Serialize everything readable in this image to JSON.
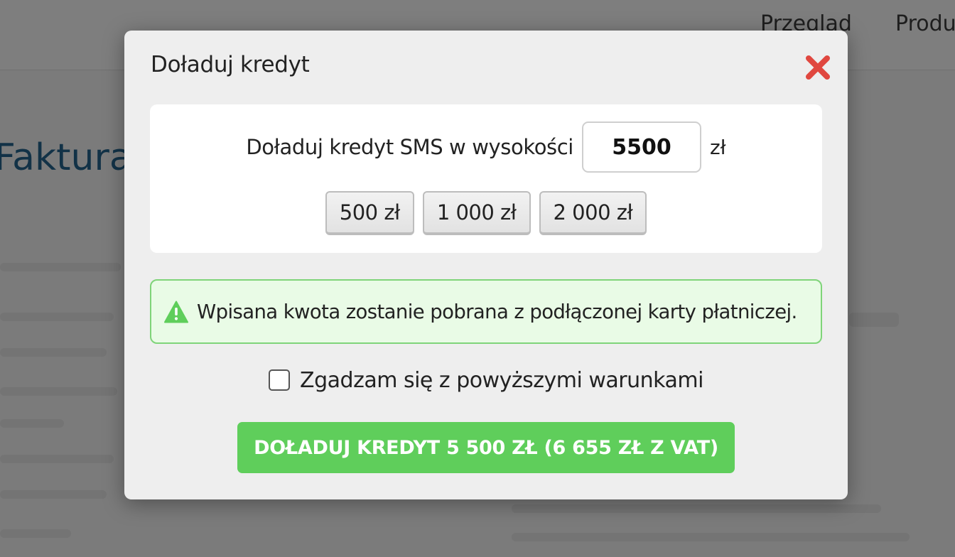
{
  "background": {
    "nav_items": [
      "Przeglad",
      "Produ"
    ],
    "heading": "Faktura"
  },
  "modal": {
    "title": "Doładuj kredyt",
    "close_icon": "close-x-icon",
    "amount_label": "Doładuj kredyt SMS w wysokości",
    "amount_value": "5500",
    "amount_unit": "zł",
    "presets": [
      "500 zł",
      "1 000 zł",
      "2 000 zł"
    ],
    "notice_icon": "warning-triangle-icon",
    "notice_text": "Wpisana kwota zostanie pobrana z podłączonej karty płatniczej.",
    "agree_label": "Zgadzam się z powyższymi warunkami",
    "agree_checked": false,
    "submit_label": "DOŁADUJ KREDYT 5 500 ZŁ (6 655 ZŁ Z VAT)"
  },
  "colors": {
    "accent_green": "#5fce5b",
    "notice_border": "#7fd479",
    "notice_background": "#e9fbe6",
    "close_red": "#e0473f",
    "overlay": "#7b7b7b"
  }
}
